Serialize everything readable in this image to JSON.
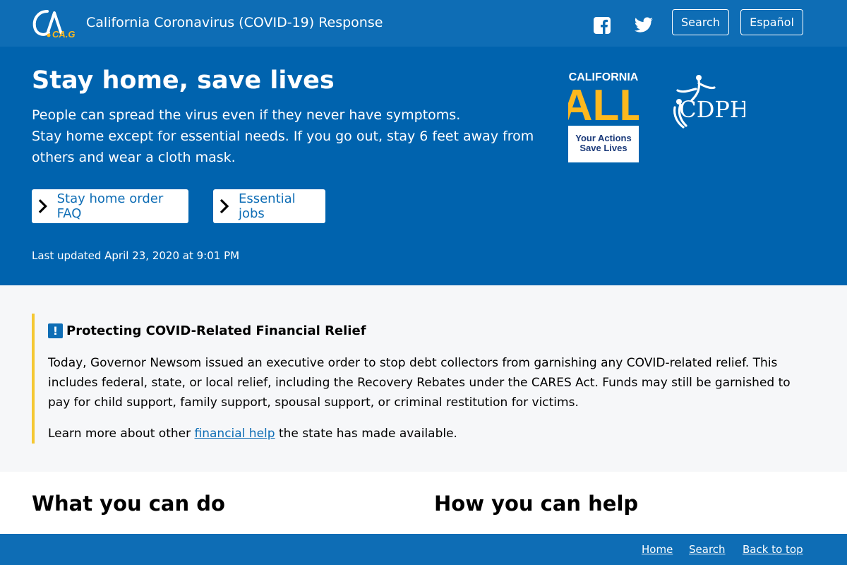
{
  "header": {
    "logo_text": "CA.GOV",
    "site_title": "California Coronavirus (COVID-19) Response",
    "facebook_icon": "facebook-icon",
    "twitter_icon": "twitter-icon",
    "search_label": "Search",
    "espanol_label": "Español"
  },
  "hero": {
    "title": "Stay home, save lives",
    "line1": "People can spread the virus even if they never have symptoms.",
    "line2": "Stay home except for essential needs. If you go out, stay 6 feet away from others and wear a cloth mask.",
    "faq_button": "Stay home order FAQ",
    "jobs_button": "Essential jobs",
    "last_updated": "Last updated April 23, 2020 at 9:01 PM",
    "ca_all": {
      "top": "CALIFORNIA",
      "big": "ALL",
      "tag1": "Your Actions",
      "tag2": "Save Lives"
    },
    "cdph_text": "CDPH"
  },
  "alert": {
    "icon": "!",
    "title": "Protecting COVID-Related Financial Relief",
    "body": "Today, Governor Newsom issued an executive order to stop debt collectors from garnishing any COVID-related relief. This includes federal, state, or local relief, including the Recovery Rebates under the CARES Act. Funds may still be garnished to pay for child support, family support, spousal support, or criminal restitution for victims.",
    "more_prefix": "Learn more about other ",
    "more_link": "financial help",
    "more_suffix": " the state has made available."
  },
  "sections": {
    "left_heading": "What you can do",
    "right_heading": "How you can help"
  },
  "footer": {
    "home": "Home",
    "search": "Search",
    "back_to_top": "Back to top"
  },
  "colors": {
    "header_blue": "#0e6db5",
    "hero_blue": "#0063ae",
    "alert_bar": "#f5c833",
    "accent_gold": "#fdb81e"
  }
}
